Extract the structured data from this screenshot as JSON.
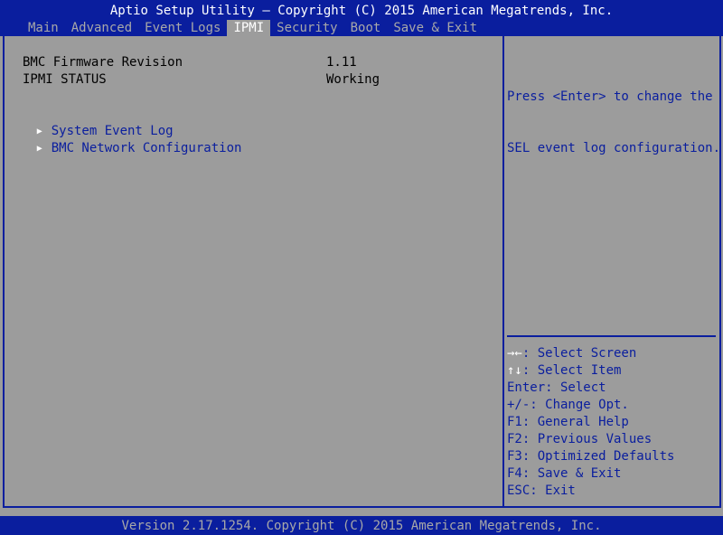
{
  "header": {
    "title": "Aptio Setup Utility – Copyright (C) 2015 American Megatrends, Inc.",
    "tabs": [
      {
        "label": "Main",
        "active": false
      },
      {
        "label": "Advanced",
        "active": false
      },
      {
        "label": "Event Logs",
        "active": false
      },
      {
        "label": "IPMI",
        "active": true
      },
      {
        "label": "Security",
        "active": false
      },
      {
        "label": "Boot",
        "active": false
      },
      {
        "label": "Save & Exit",
        "active": false
      }
    ]
  },
  "main": {
    "info": [
      {
        "label": "BMC Firmware Revision",
        "value": "1.11"
      },
      {
        "label": "IPMI STATUS",
        "value": "Working"
      }
    ],
    "menu": [
      {
        "label": "System Event Log",
        "icon": "submenu-arrow-icon"
      },
      {
        "label": "BMC Network Configuration",
        "icon": "submenu-arrow-icon"
      }
    ]
  },
  "help": {
    "text_lines": [
      "Press <Enter> to change the",
      "SEL event log configuration."
    ]
  },
  "keys": [
    {
      "symbol": "→←",
      "text": ": Select Screen"
    },
    {
      "symbol": "↑↓",
      "text": ": Select Item"
    },
    {
      "symbol": "",
      "text": "Enter: Select"
    },
    {
      "symbol": "",
      "text": "+/-: Change Opt."
    },
    {
      "symbol": "",
      "text": "F1: General Help"
    },
    {
      "symbol": "",
      "text": "F2: Previous Values"
    },
    {
      "symbol": "",
      "text": "F3: Optimized Defaults"
    },
    {
      "symbol": "",
      "text": "F4: Save & Exit"
    },
    {
      "symbol": "",
      "text": "ESC: Exit"
    }
  ],
  "footer": {
    "text": "Version 2.17.1254. Copyright (C) 2015 American Megatrends, Inc."
  },
  "colors": {
    "bar": "#0a1e9e",
    "panel": "#9c9c9c",
    "link": "#0a1e9e",
    "highlight": "#ffffff"
  }
}
